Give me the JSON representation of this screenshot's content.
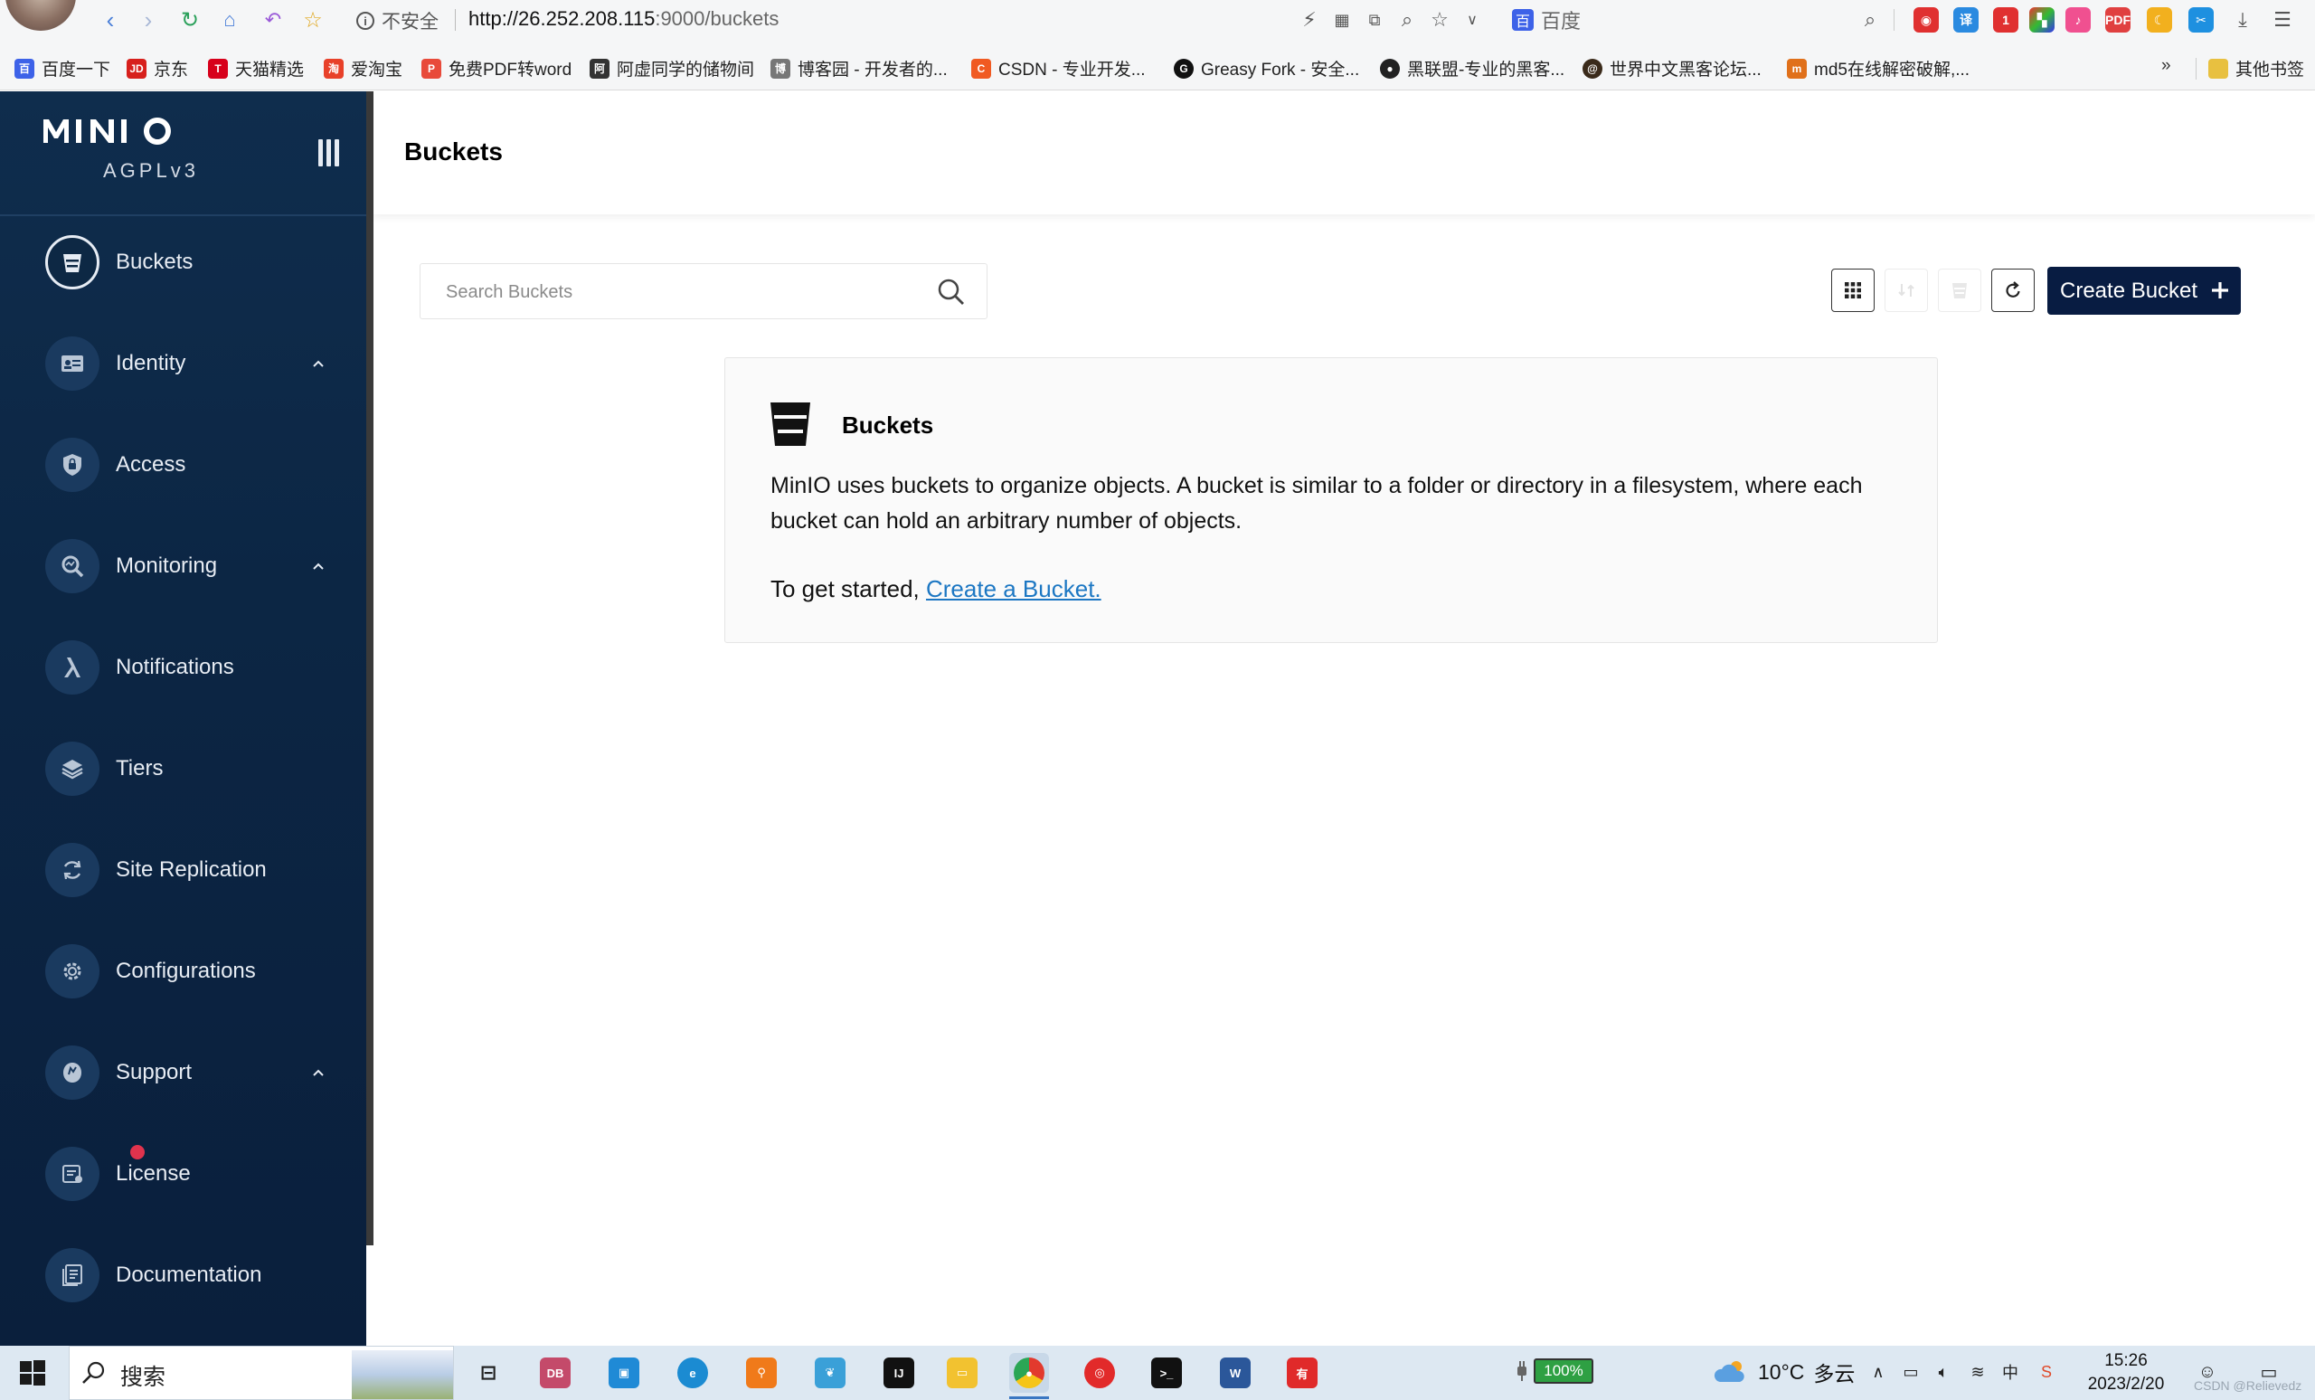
{
  "browser": {
    "security_label": "不安全",
    "url_host": "http://26.252.208.115",
    "url_rest": ":9000/buckets",
    "search_engine": "百度",
    "bookmarks": [
      {
        "label": "百度一下",
        "color": "#3d62e8"
      },
      {
        "label": "京东",
        "color": "#d7201c"
      },
      {
        "label": "天猫精选",
        "color": "#d7001b"
      },
      {
        "label": "爱淘宝",
        "color": "#e8412a"
      },
      {
        "label": "免费PDF转word",
        "color": "#e84a3a"
      },
      {
        "label": "阿虚同学的储物间",
        "color": "#333333"
      },
      {
        "label": "博客园 - 开发者的...",
        "color": "#444444"
      },
      {
        "label": "CSDN - 专业开发...",
        "color": "#f05a22"
      },
      {
        "label": "Greasy Fork - 安全...",
        "color": "#111111"
      },
      {
        "label": "黑联盟-专业的黑客...",
        "color": "#222222"
      },
      {
        "label": "世界中文黑客论坛...",
        "color": "#3a2a1a"
      },
      {
        "label": "md5在线解密破解,...",
        "color": "#e0701a"
      },
      {
        "label": "其他书签",
        "color": "#e8c040"
      }
    ],
    "more_bookmarks": "»"
  },
  "sidebar": {
    "brand": "MINIO",
    "license": "AGPLv3",
    "items": [
      {
        "label": "Buckets",
        "icon": "bucket-icon",
        "active": true,
        "expandable": false
      },
      {
        "label": "Identity",
        "icon": "id-card-icon",
        "active": false,
        "expandable": true
      },
      {
        "label": "Access",
        "icon": "lock-icon",
        "active": false,
        "expandable": false
      },
      {
        "label": "Monitoring",
        "icon": "monitor-search-icon",
        "active": false,
        "expandable": true
      },
      {
        "label": "Notifications",
        "icon": "lambda-icon",
        "active": false,
        "expandable": false
      },
      {
        "label": "Tiers",
        "icon": "layers-icon",
        "active": false,
        "expandable": false
      },
      {
        "label": "Site Replication",
        "icon": "replication-icon",
        "active": false,
        "expandable": false
      },
      {
        "label": "Configurations",
        "icon": "gear-icon",
        "active": false,
        "expandable": false
      },
      {
        "label": "Support",
        "icon": "support-icon",
        "active": false,
        "expandable": true
      },
      {
        "label": "License",
        "icon": "license-icon",
        "active": false,
        "expandable": false,
        "badge": true
      },
      {
        "label": "Documentation",
        "icon": "document-icon",
        "active": false,
        "expandable": false
      }
    ]
  },
  "main": {
    "title": "Buckets",
    "search": {
      "placeholder": "Search Buckets",
      "value": ""
    },
    "create_button": "Create Bucket",
    "card": {
      "title": "Buckets",
      "body": "MinIO uses buckets to organize objects. A bucket is similar to a folder or directory in a filesystem, where each bucket can hold an arbitrary number of objects.",
      "cta_prefix": "To get started, ",
      "cta_link": "Create a Bucket."
    }
  },
  "taskbar": {
    "search_label": "搜索",
    "battery": "100%",
    "weather_temp": "10°C",
    "weather_desc": "多云",
    "time": "15:26",
    "date": "2023/2/20"
  },
  "watermark": "CSDN @Relievedz",
  "colors": {
    "sidebar_bg": "#0c2644",
    "primary_button": "#081c42",
    "link": "#1c77c3",
    "badge": "#e0334d"
  }
}
